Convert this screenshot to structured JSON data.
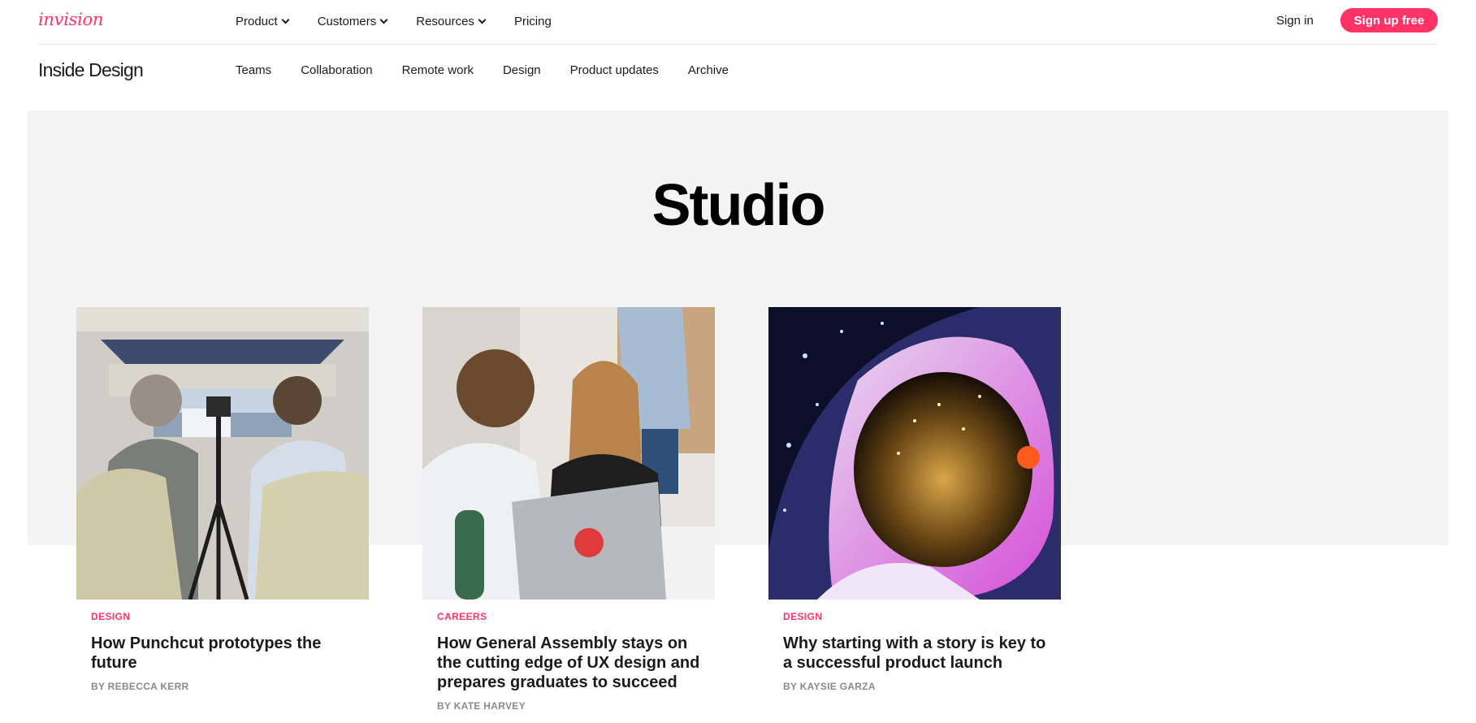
{
  "header": {
    "logo": "invision",
    "nav": [
      {
        "label": "Product",
        "dropdown": true
      },
      {
        "label": "Customers",
        "dropdown": true
      },
      {
        "label": "Resources",
        "dropdown": true
      },
      {
        "label": "Pricing",
        "dropdown": false
      }
    ],
    "sign_in": "Sign in",
    "sign_up": "Sign up free"
  },
  "subheader": {
    "brand": "Inside Design",
    "nav": [
      "Teams",
      "Collaboration",
      "Remote work",
      "Design",
      "Product updates",
      "Archive"
    ]
  },
  "hero": {
    "title": "Studio"
  },
  "articles": [
    {
      "category": "Design",
      "title": "How Punchcut prototypes the future",
      "byline": "By Rebecca Kerr"
    },
    {
      "category": "Careers",
      "title": "How General Assembly stays on the cutting edge of UX design and prepares graduates to succeed",
      "byline": "By Kate Harvey"
    },
    {
      "category": "Design",
      "title": "Why starting with a story is key to a successful product launch",
      "byline": "By Kaysie Garza"
    }
  ],
  "colors": {
    "accent": "#ff3366",
    "hero_bg": "#f4f4f4",
    "text": "#1b1b1b",
    "muted": "#8a8a8a"
  }
}
